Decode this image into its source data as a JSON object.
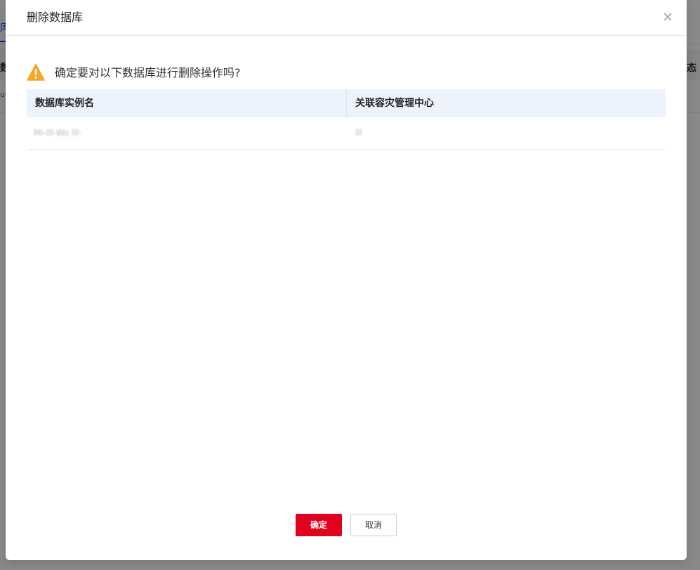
{
  "background": {
    "tab_label": "库",
    "col_left": "数据",
    "col_right": "态",
    "row_left": "us"
  },
  "modal": {
    "title": "删除数据库",
    "warning": "确定要对以下数据库进行删除操作吗?",
    "table": {
      "headers": [
        "数据库实例名",
        "关联容灾管理中心"
      ],
      "rows": [
        [
          "Mi-lll-Wo lll-",
          "lll"
        ]
      ]
    },
    "confirm_label": "确定",
    "cancel_label": "取消"
  },
  "colors": {
    "primary": "#e1001e",
    "warning": "#f5a623",
    "header_bg": "#eef2fb"
  }
}
